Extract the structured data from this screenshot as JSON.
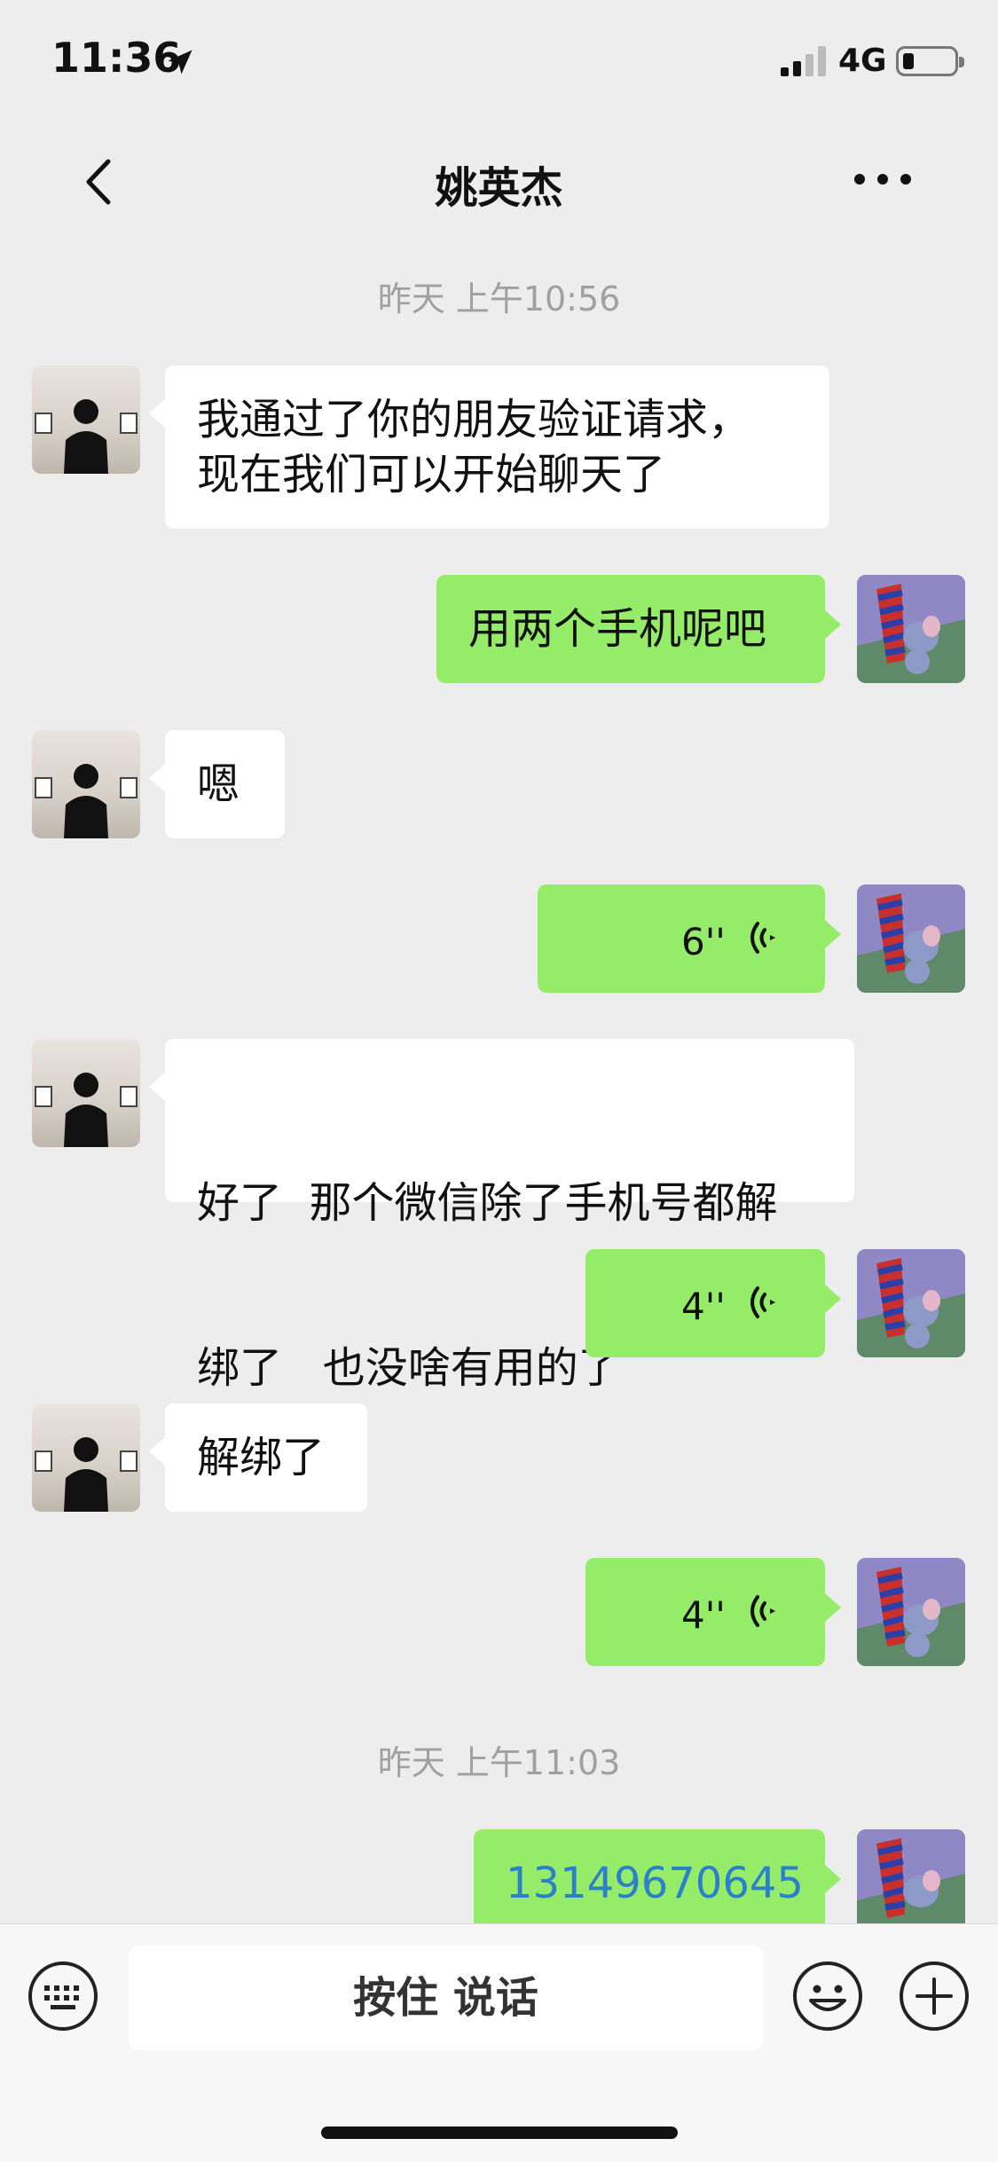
{
  "status_bar": {
    "time": "11:36",
    "network": "4G",
    "location_icon": "location-arrow-icon",
    "signal_icon": "signal-icon",
    "battery_icon": "battery-icon"
  },
  "header": {
    "title": "姚英杰",
    "back_icon": "chevron-left-icon",
    "more_icon": "more-dots-icon"
  },
  "messages": [
    {
      "type": "time",
      "text": "昨天 上午10:56"
    },
    {
      "type": "text",
      "side": "left",
      "lines": [
        "我通过了你的朋友验证请求，",
        "现在我们可以开始聊天了"
      ]
    },
    {
      "type": "text",
      "side": "right",
      "text": "用两个手机呢吧"
    },
    {
      "type": "text",
      "side": "left",
      "text": "嗯"
    },
    {
      "type": "voice",
      "side": "right",
      "duration": "6''"
    },
    {
      "type": "text",
      "side": "left",
      "lines": [
        "好了  那个微信除了手机号都解",
        "绑了   也没啥有用的了"
      ]
    },
    {
      "type": "voice",
      "side": "right",
      "duration": "4''"
    },
    {
      "type": "text",
      "side": "left",
      "text": "解绑了"
    },
    {
      "type": "voice",
      "side": "right",
      "duration": "4''"
    },
    {
      "type": "time",
      "text": "昨天 上午11:03"
    },
    {
      "type": "text",
      "side": "right",
      "text": "13149670645",
      "link": true
    }
  ],
  "input_bar": {
    "hold_to_talk": "按住 说话",
    "keyboard_icon": "keyboard-icon",
    "emoji_icon": "emoji-icon",
    "plus_icon": "plus-icon"
  },
  "colors": {
    "background": "#ededed",
    "bubble_self": "#95ec69",
    "bubble_other": "#ffffff",
    "link": "#2c7fc9",
    "timestamp": "#a0a0a0"
  }
}
